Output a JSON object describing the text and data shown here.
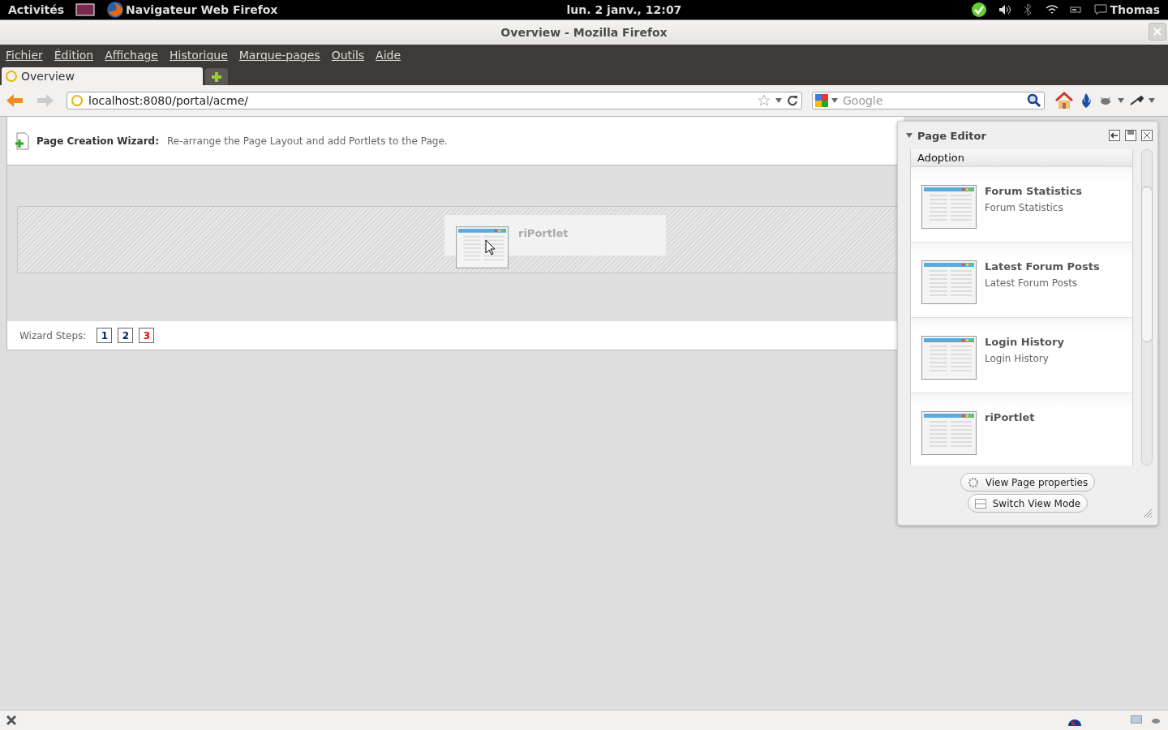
{
  "top_bar": {
    "activities": "Activités",
    "app_name": "Navigateur Web Firefox",
    "clock": "lun.  2 janv., 12:07",
    "user": "Thomas"
  },
  "window": {
    "title": "Overview - Mozilla Firefox"
  },
  "menu": [
    "Fichier",
    "Édition",
    "Affichage",
    "Historique",
    "Marque-pages",
    "Outils",
    "Aide"
  ],
  "tabs": [
    {
      "label": "Overview",
      "selected": true
    }
  ],
  "address_bar": {
    "value": "localhost:8080/portal/acme/"
  },
  "search": {
    "placeholder": "Google"
  },
  "wizard": {
    "title": "Page Creation Wizard:",
    "description": "Re-arrange the Page Layout and add Portlets to the Page.",
    "steps_label": "Wizard Steps:",
    "steps": [
      {
        "label": "1",
        "selected": false
      },
      {
        "label": "2",
        "selected": false
      },
      {
        "label": "3",
        "selected": true
      }
    ]
  },
  "drag_preview": {
    "label": "riPortlet"
  },
  "page_editor": {
    "title": "Page Editor",
    "category": "Adoption",
    "portlets": [
      {
        "name": "Forum Statistics",
        "description": "Forum Statistics"
      },
      {
        "name": "Latest Forum Posts",
        "description": "Latest Forum Posts"
      },
      {
        "name": "Login History",
        "description": "Login History"
      },
      {
        "name": "riPortlet"
      }
    ],
    "buttons": [
      {
        "kind": "properties",
        "label": "View Page properties"
      },
      {
        "kind": "view",
        "label": "Switch View Mode"
      }
    ]
  }
}
